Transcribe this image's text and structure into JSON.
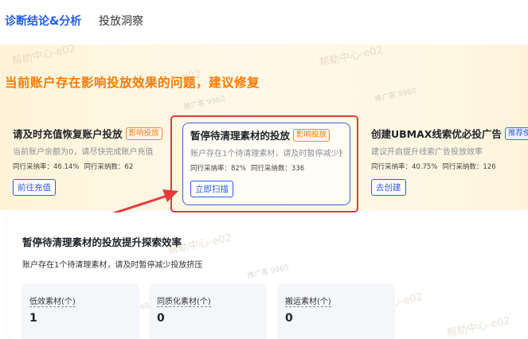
{
  "tabs": [
    {
      "label": "诊断结论&分析",
      "active": true
    },
    {
      "label": "投放洞察",
      "active": false
    }
  ],
  "banner": {
    "title": "当前账户存在影响投放效果的问题，建议修复",
    "color": "#ff7a00"
  },
  "watermark": {
    "main": "帮助中心-e02",
    "small": "推广客 9960"
  },
  "cards": [
    {
      "title": "请及时充值恢复账户投放",
      "badge": "影响投放",
      "desc": "当前账户余额为0，请尽快完成账户充值",
      "stat_rate": "同行采纳率：46.14%",
      "stat_count": "同行采纳数：62",
      "button": "前往充值"
    },
    {
      "title": "暂停待清理素材的投放",
      "badge": "影响投放",
      "desc": "账户存在1个待清理素材，请及时暂停减少投…",
      "stat_rate": "同行采纳率：82%",
      "stat_count": "同行采纳数：336",
      "button": "立即扫描"
    },
    {
      "title": "创建UBMAX线索优必投广告",
      "badge": "推荐使用",
      "desc": "建议开启提升线索广告投放效率",
      "stat_rate": "同行采纳率：40.75%",
      "stat_count": "同行采纳数：126",
      "button": "去创建"
    }
  ],
  "detail": {
    "title": "暂停待清理素材的投放提升探索效率",
    "subtitle": "账户存在1个待清理素材，请及时暂停减少投放挤压",
    "metrics": [
      {
        "label": "低效素材(个)",
        "value": "1"
      },
      {
        "label": "同质化素材(个)",
        "value": "0"
      },
      {
        "label": "搬运素材(个)",
        "value": "0"
      }
    ]
  },
  "colors": {
    "accent": "#2e5ce8",
    "warning": "#ff7a00",
    "highlight": "#e8393a"
  }
}
